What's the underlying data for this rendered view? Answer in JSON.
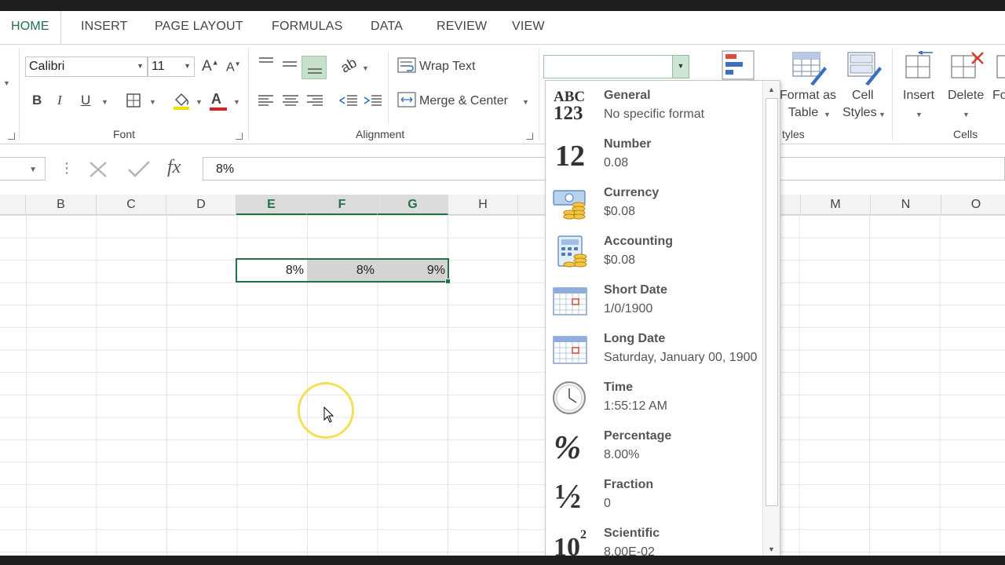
{
  "tabs": [
    "HOME",
    "INSERT",
    "PAGE LAYOUT",
    "FORMULAS",
    "DATA",
    "REVIEW",
    "VIEW"
  ],
  "ribbon": {
    "font_name": "Calibri",
    "font_size": "11",
    "bold": "B",
    "italic": "I",
    "underline": "U",
    "font_color_glyph": "A",
    "font_group_label": "Font",
    "wrap_text": "Wrap Text",
    "merge_center": "Merge & Center",
    "alignment_group_label": "Alignment",
    "format_as": "Format as",
    "table": "Table",
    "cell": "Cell",
    "styles": "Styles",
    "styles_group_label": "tyles",
    "insert": "Insert",
    "delete": "Delete",
    "format_cut": "Fo",
    "cells_group_label": "Cells"
  },
  "formula_bar": {
    "fx": "fx",
    "value": "8%"
  },
  "grid": {
    "columns": [
      "B",
      "C",
      "D",
      "E",
      "F",
      "G",
      "H",
      "M",
      "N",
      "O"
    ],
    "cells": [
      "8%",
      "8%",
      "9%"
    ]
  },
  "number_format": {
    "items": [
      {
        "title": "General",
        "sample": "No specific format",
        "icon": "abc-123-icon"
      },
      {
        "title": "Number",
        "sample": "0.08",
        "icon": "number-12-icon"
      },
      {
        "title": "Currency",
        "sample": "$0.08",
        "icon": "currency-icon"
      },
      {
        "title": "Accounting",
        "sample": " $0.08",
        "icon": "accounting-icon"
      },
      {
        "title": "Short Date",
        "sample": "1/0/1900",
        "icon": "calendar-icon"
      },
      {
        "title": "Long Date",
        "sample": "Saturday, January 00, 1900",
        "icon": "calendar-icon"
      },
      {
        "title": "Time",
        "sample": "1:55:12 AM",
        "icon": "clock-icon"
      },
      {
        "title": "Percentage",
        "sample": "8.00%",
        "icon": "percent-icon"
      },
      {
        "title": "Fraction",
        "sample": "0",
        "icon": "fraction-icon"
      },
      {
        "title": "Scientific",
        "sample": "8.00E-02",
        "icon": "scientific-icon"
      }
    ],
    "icon_glyphs": {
      "abc_top": "ABC",
      "abc_bottom": "123",
      "number": "12",
      "percent": "%",
      "fraction": "½",
      "sci_base": "10",
      "sci_exp": "2"
    }
  },
  "colors": {
    "accent": "#217346",
    "selection_fill": "#d4d4d4",
    "cursor_halo": "#f1e05a"
  }
}
